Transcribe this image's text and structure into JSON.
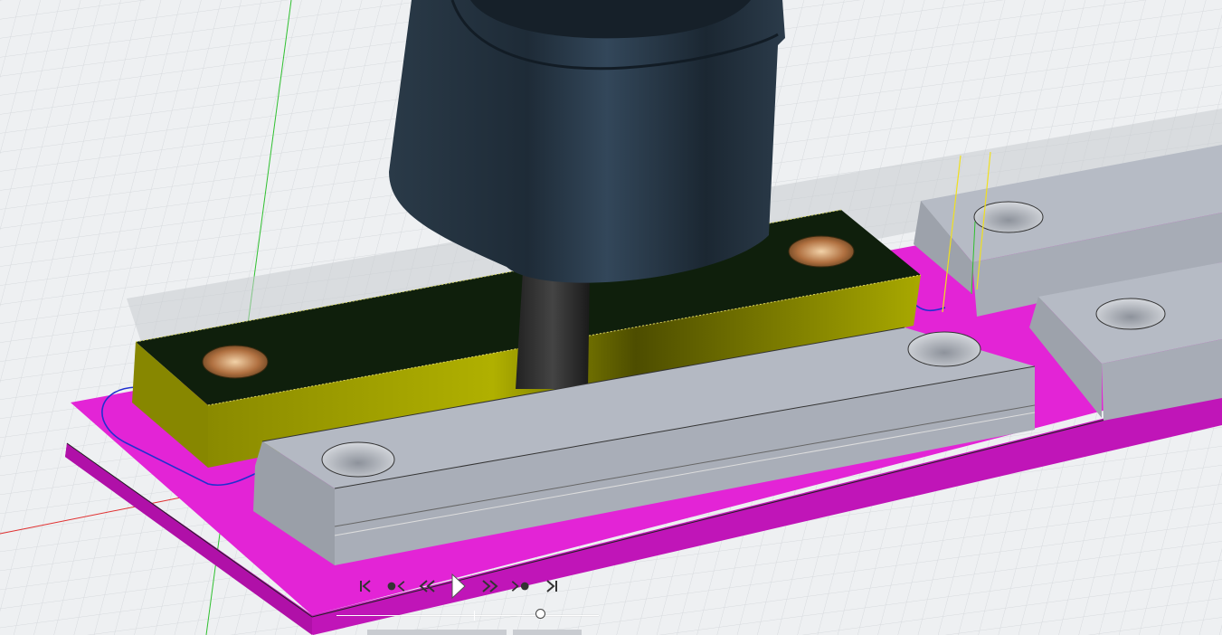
{
  "scene": {
    "background": "#eef0f2",
    "grid_color": "#d3d6da",
    "fixture_plate_color": "#e020d0",
    "stock_color": "#a8a800",
    "stock_top_color": "#0f1f0c",
    "clamp_color": "#b8bcc6",
    "tool_holder_color": "#1f2c38",
    "toolpath_color": "#2030d0",
    "axis_colors": {
      "x": "#e03030",
      "y": "#30c030"
    }
  },
  "playback": {
    "controls": [
      {
        "name": "go-to-start-button",
        "icon": "skip-to-start-icon"
      },
      {
        "name": "previous-operation-button",
        "icon": "previous-operation-icon"
      },
      {
        "name": "step-back-button",
        "icon": "step-back-icon"
      },
      {
        "name": "play-button",
        "icon": "play-icon"
      },
      {
        "name": "step-forward-button",
        "icon": "step-forward-icon"
      },
      {
        "name": "next-operation-button",
        "icon": "next-operation-icon"
      },
      {
        "name": "go-to-end-button",
        "icon": "skip-to-end-icon"
      }
    ],
    "timeline_position": 0.78
  }
}
